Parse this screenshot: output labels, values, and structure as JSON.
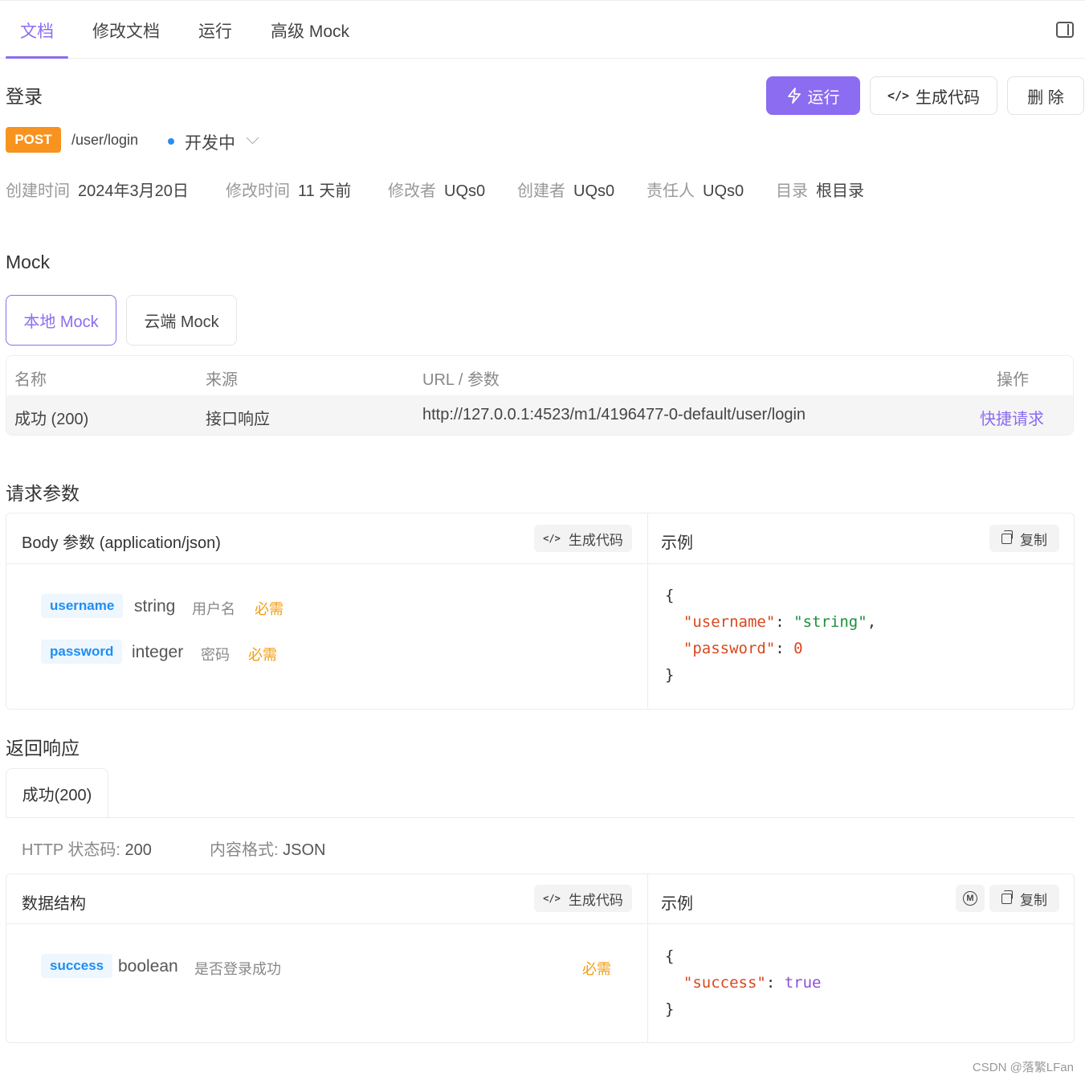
{
  "tabs": [
    "文档",
    "修改文档",
    "运行",
    "高级 Mock"
  ],
  "header": {
    "title": "登录",
    "run_label": "运行",
    "gen_code_label": "生成代码",
    "delete_label": "删 除"
  },
  "api": {
    "method": "POST",
    "path": "/user/login",
    "status": "开发中",
    "status_color": "#2b8ef0",
    "method_color": "#f7931e"
  },
  "meta": [
    {
      "key": "创建时间",
      "value": "2024年3月20日"
    },
    {
      "key": "修改时间",
      "value": "11 天前"
    },
    {
      "key": "修改者",
      "value": "UQs0"
    },
    {
      "key": "创建者",
      "value": "UQs0"
    },
    {
      "key": "责任人",
      "value": "UQs0"
    },
    {
      "key": "目录",
      "value": "根目录"
    }
  ],
  "mock": {
    "title": "Mock",
    "tabs": [
      "本地 Mock",
      "云端 Mock"
    ],
    "columns": [
      "名称",
      "来源",
      "URL / 参数",
      "操作"
    ],
    "row": {
      "name": "成功 (200)",
      "source": "接口响应",
      "url": "http://127.0.0.1:4523/m1/4196477-0-default/user/login",
      "action": "快捷请求"
    }
  },
  "request": {
    "title": "请求参数",
    "body_title": "Body 参数 (application/json)",
    "gen_code_label": "生成代码",
    "example_title": "示例",
    "copy_label": "复制",
    "fields": [
      {
        "name": "username",
        "type": "string",
        "desc": "用户名",
        "required": "必需"
      },
      {
        "name": "password",
        "type": "integer",
        "desc": "密码",
        "required": "必需"
      }
    ],
    "example_lines": [
      "{",
      "\"username\"",
      ": ",
      "\"string\"",
      ",",
      "\"password\"",
      ": ",
      "0",
      "}"
    ]
  },
  "response": {
    "title": "返回响应",
    "tab": "成功(200)",
    "http_label": "HTTP 状态码: ",
    "http_value": "200",
    "format_label": "内容格式: ",
    "format_value": "JSON",
    "struct_title": "数据结构",
    "gen_code_label": "生成代码",
    "example_title": "示例",
    "copy_label": "复制",
    "mock_icon_label": "M",
    "fields": [
      {
        "name": "success",
        "type": "boolean",
        "desc": "是否登录成功",
        "required": "必需"
      }
    ],
    "example_key": "\"success\"",
    "example_value": "true"
  },
  "accent_color": "#8c6cf0",
  "watermark": "CSDN @落繁LFan"
}
